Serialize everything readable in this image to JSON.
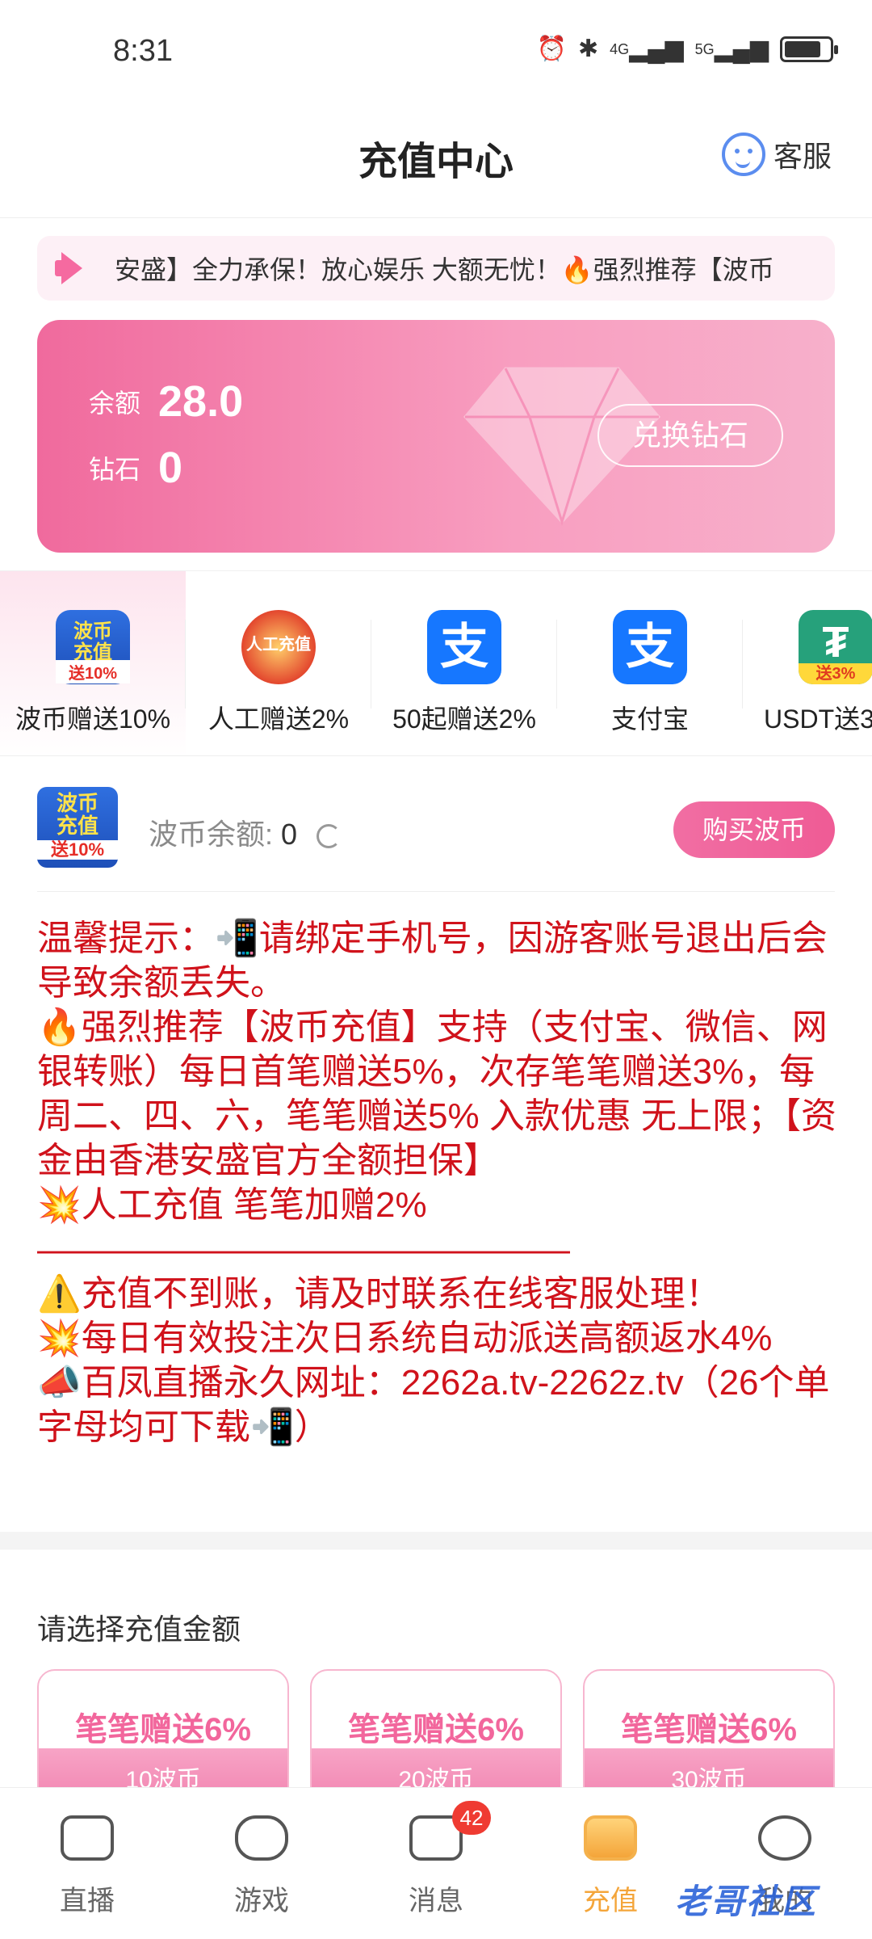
{
  "status_bar": {
    "time": "8:31",
    "net1": "4G",
    "net2": "5G"
  },
  "header": {
    "title": "充值中心",
    "service_label": "客服"
  },
  "notice": {
    "text": "安盛】全力承保！放心娱乐 大额无忧！🔥强烈推荐【波币"
  },
  "balance_card": {
    "balance_label": "余额",
    "balance_value": "28.0",
    "diamond_label": "钻石",
    "diamond_value": "0",
    "exchange_label": "兑换钻石"
  },
  "pay_methods": [
    {
      "label": "波币赠送10%",
      "icon": "bobi-icon",
      "icon_text1": "波币",
      "icon_text2": "充值",
      "icon_text3": "送10%"
    },
    {
      "label": "人工赠送2%",
      "icon": "manual-recharge-icon",
      "icon_text1": "人工充值"
    },
    {
      "label": "50起赠送2%",
      "icon": "alipay-icon",
      "icon_text1": "支"
    },
    {
      "label": "支付宝",
      "icon": "alipay-icon",
      "icon_text1": "支"
    },
    {
      "label": "USDT送3",
      "icon": "usdt-icon",
      "icon_text1": "₮",
      "icon_text2": "送3%"
    }
  ],
  "bobi": {
    "logo_text1": "波币",
    "logo_text2": "充值",
    "logo_text3": "送10%",
    "balance_label": "波币余额:",
    "balance_value": "0",
    "buy_label": "购买波币"
  },
  "tips": [
    "温馨提示：📲请绑定手机号，因游客账号退出后会导致余额丢失。",
    "🔥强烈推荐【波币充值】支持（支付宝、微信、网银转账）每日首笔赠送5%，次存笔笔赠送3%，每周二、四、六，笔笔赠送5% 入款优惠 无上限；【资金由香港安盛官方全额担保】",
    "💥人工充值 笔笔加赠2%",
    "———————————————",
    "⚠️充值不到账，请及时联系在线客服处理！",
    "💥每日有效投注次日系统自动派送高额返水4%",
    "📣百凤直播永久网址：2262a.tv-2262z.tv（26个单字母均可下载📲）"
  ],
  "amount_section": {
    "title": "请选择充值金额",
    "cards": [
      {
        "bonus": "笔笔赠送6%",
        "amount": "10波币"
      },
      {
        "bonus": "笔笔赠送6%",
        "amount": "20波币"
      },
      {
        "bonus": "笔笔赠送6%",
        "amount": "30波币"
      }
    ]
  },
  "bottom_nav": [
    {
      "label": "直播",
      "icon": "live-camera-icon"
    },
    {
      "label": "游戏",
      "icon": "gamepad-icon"
    },
    {
      "label": "消息",
      "icon": "message-icon",
      "badge": "42"
    },
    {
      "label": "充值",
      "icon": "wallet-icon",
      "active": true
    },
    {
      "label": "我的",
      "icon": "profile-icon"
    }
  ],
  "watermark": "老哥社区"
}
